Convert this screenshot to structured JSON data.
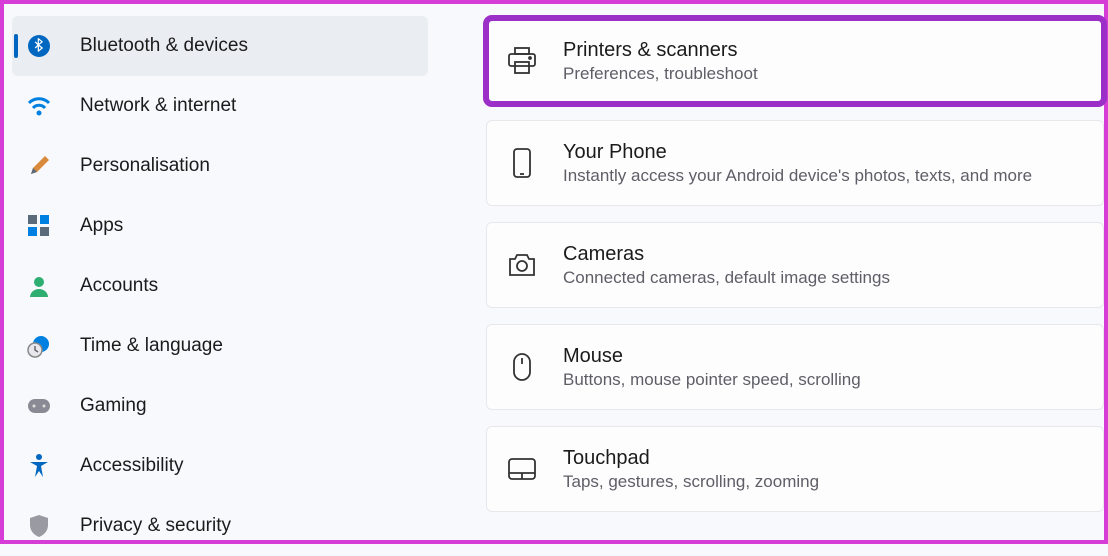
{
  "sidebar": {
    "items": [
      {
        "label": "Bluetooth & devices",
        "icon": "bluetooth-icon",
        "selected": true
      },
      {
        "label": "Network & internet",
        "icon": "wifi-icon",
        "selected": false
      },
      {
        "label": "Personalisation",
        "icon": "brush-icon",
        "selected": false
      },
      {
        "label": "Apps",
        "icon": "apps-icon",
        "selected": false
      },
      {
        "label": "Accounts",
        "icon": "person-icon",
        "selected": false
      },
      {
        "label": "Time & language",
        "icon": "clock-globe-icon",
        "selected": false
      },
      {
        "label": "Gaming",
        "icon": "gamepad-icon",
        "selected": false
      },
      {
        "label": "Accessibility",
        "icon": "accessibility-icon",
        "selected": false
      },
      {
        "label": "Privacy & security",
        "icon": "shield-icon",
        "selected": false
      }
    ]
  },
  "colors": {
    "accent": "#0067c0",
    "highlight": "#9b2fc7"
  },
  "main": {
    "cards": [
      {
        "title": "Printers & scanners",
        "sub": "Preferences, troubleshoot",
        "icon": "printer-icon",
        "highlighted": true
      },
      {
        "title": "Your Phone",
        "sub": "Instantly access your Android device's photos, texts, and more",
        "icon": "phone-icon",
        "highlighted": false
      },
      {
        "title": "Cameras",
        "sub": "Connected cameras, default image settings",
        "icon": "camera-icon",
        "highlighted": false
      },
      {
        "title": "Mouse",
        "sub": "Buttons, mouse pointer speed, scrolling",
        "icon": "mouse-icon",
        "highlighted": false
      },
      {
        "title": "Touchpad",
        "sub": "Taps, gestures, scrolling, zooming",
        "icon": "touchpad-icon",
        "highlighted": false
      }
    ]
  }
}
